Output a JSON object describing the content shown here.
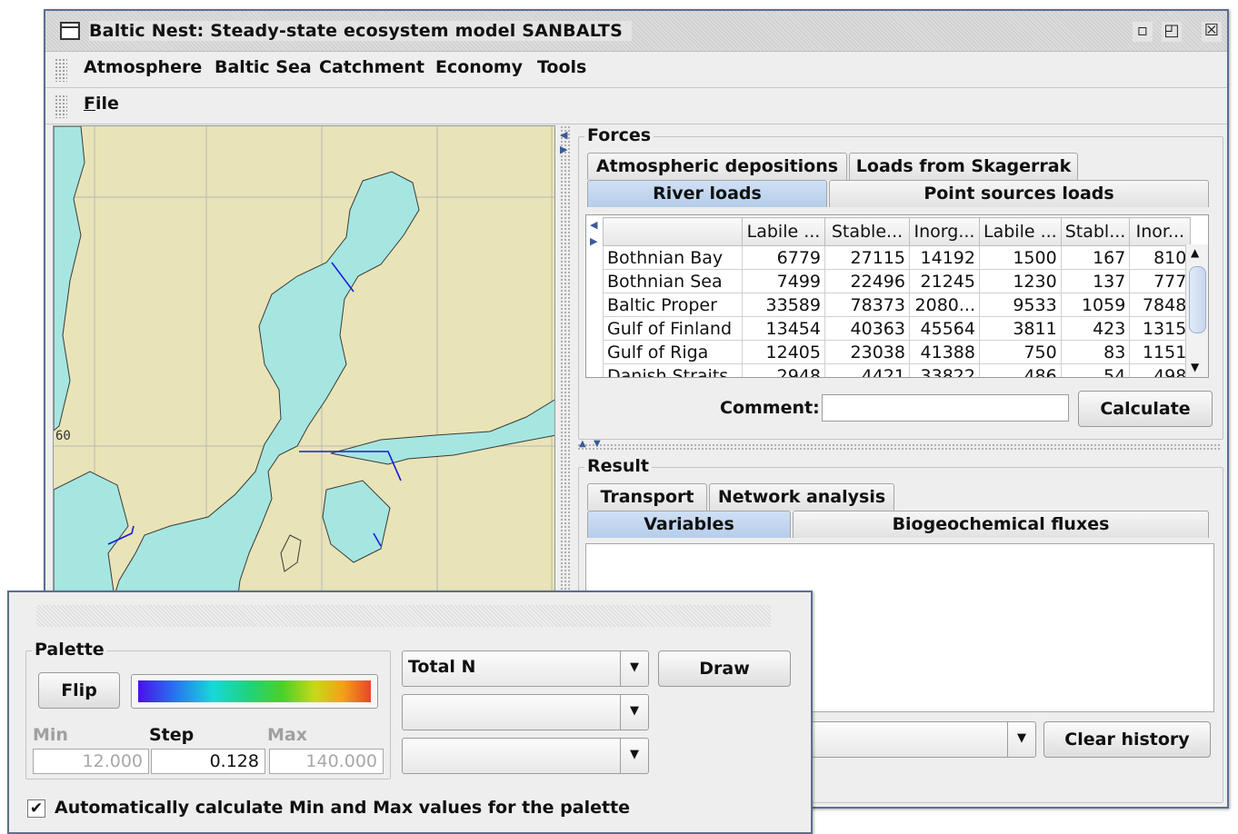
{
  "window": {
    "title": "Baltic Nest: Steady-state ecosystem model SANBALTS",
    "buttons": {
      "minimize": "▫",
      "maximize": "◰",
      "close": "☒"
    }
  },
  "menubar": [
    "Atmosphere",
    "Baltic Sea",
    "Catchment",
    "Economy",
    "Tools"
  ],
  "toolbar": {
    "file_mnemonic": "F",
    "file_rest": "ile"
  },
  "map": {
    "latitude_label": "60"
  },
  "forces": {
    "title": "Forces",
    "tabs_row1": [
      "Atmospheric depositions",
      "Loads from Skagerrak"
    ],
    "tabs_row2": [
      "River loads",
      "Point sources loads"
    ],
    "selected_tab": "River loads",
    "table": {
      "columns": [
        "",
        "Labile ...",
        "Stable...",
        "Inorg...",
        "Labile ...",
        "Stabl...",
        "Inor..."
      ],
      "rows": [
        [
          "Bothnian Bay",
          "6779",
          "27115",
          "14192",
          "1500",
          "167",
          "810"
        ],
        [
          "Bothnian Sea",
          "7499",
          "22496",
          "21245",
          "1230",
          "137",
          "777"
        ],
        [
          "Baltic Proper",
          "33589",
          "78373",
          "2080...",
          "9533",
          "1059",
          "7848"
        ],
        [
          "Gulf of Finland",
          "13454",
          "40363",
          "45564",
          "3811",
          "423",
          "1315"
        ],
        [
          "Gulf of Riga",
          "12405",
          "23038",
          "41388",
          "750",
          "83",
          "1151"
        ],
        [
          "Danish Straits",
          "2948",
          "4421",
          "33822",
          "486",
          "54",
          "498"
        ]
      ]
    },
    "comment_label": "Comment:",
    "comment_value": "",
    "calculate_label": "Calculate"
  },
  "result": {
    "title": "Result",
    "tabs_row1": [
      "Transport",
      "Network analysis"
    ],
    "tabs_row2": [
      "Variables",
      "Biogeochemical fluxes"
    ],
    "selected_tab": "Variables",
    "history_value": "",
    "clear_history_label": "Clear history"
  },
  "palette_window": {
    "group_title": "Palette",
    "flip_label": "Flip",
    "min_label": "Min",
    "step_label": "Step",
    "max_label": "Max",
    "min_value": "12.000",
    "step_value": "0.128",
    "max_value": "140.000",
    "variable_select": "Total N",
    "select2": "",
    "select3": "",
    "draw_label": "Draw",
    "auto_checkbox_checked": true,
    "auto_checkbox_label": "Automatically calculate Min and Max values for the palette"
  },
  "colors": {
    "sea": "#a6e6e0",
    "land": "#e8e4b8",
    "selected_tab": "#bcd2ed",
    "window_border": "#5b6f8f"
  }
}
